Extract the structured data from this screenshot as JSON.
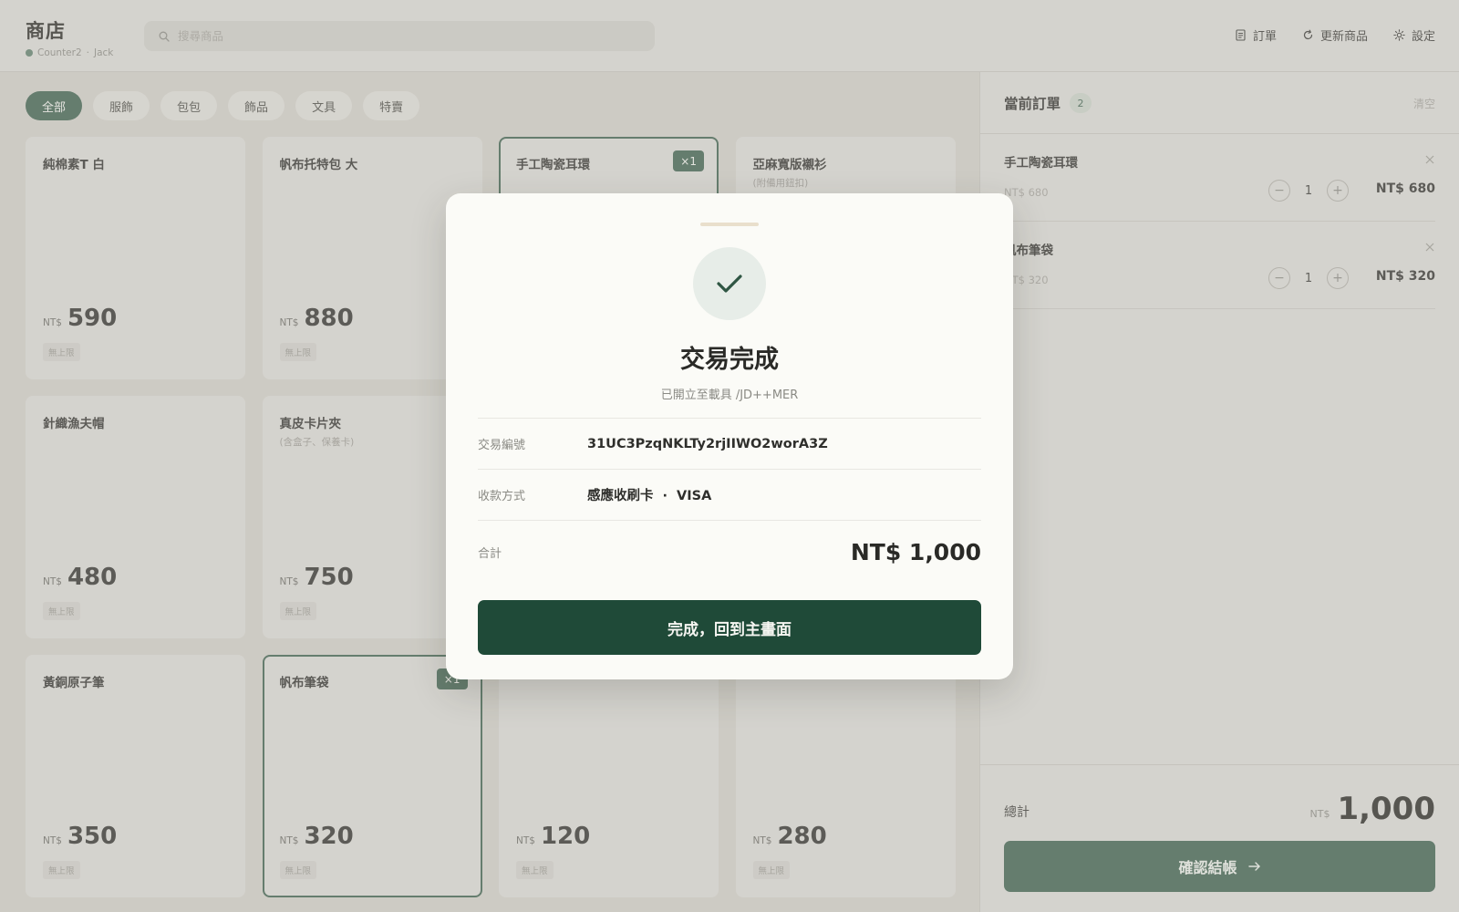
{
  "header": {
    "title": "商店",
    "device": "Counter2",
    "separator": "·",
    "user": "Jack",
    "search_placeholder": "搜尋商品",
    "actions": [
      {
        "label": "訂單",
        "icon": "receipt-icon"
      },
      {
        "label": "更新商品",
        "icon": "refresh-icon"
      },
      {
        "label": "設定",
        "icon": "gear-icon"
      }
    ]
  },
  "categories": [
    {
      "label": "全部",
      "active": true
    },
    {
      "label": "服飾",
      "active": false
    },
    {
      "label": "包包",
      "active": false
    },
    {
      "label": "飾品",
      "active": false
    },
    {
      "label": "文具",
      "active": false
    },
    {
      "label": "特賣",
      "active": false
    }
  ],
  "products": [
    {
      "name": "純棉素T 白",
      "note": "",
      "currency": "NT$",
      "price": "590",
      "badge": "無上限",
      "qty": ""
    },
    {
      "name": "帆布托特包 大",
      "note": "",
      "currency": "NT$",
      "price": "880",
      "badge": "無上限",
      "qty": ""
    },
    {
      "name": "手工陶瓷耳環",
      "note": "",
      "currency": "",
      "price": "",
      "badge": "",
      "qty": "×1"
    },
    {
      "name": "亞麻寬版襯衫",
      "note": "(附備用鈕扣)",
      "currency": "",
      "price": "",
      "badge": "",
      "qty": ""
    },
    {
      "name": "針織漁夫帽",
      "note": "",
      "currency": "NT$",
      "price": "480",
      "badge": "無上限",
      "qty": ""
    },
    {
      "name": "真皮卡片夾",
      "note": "(含盒子、保養卡)",
      "currency": "NT$",
      "price": "750",
      "badge": "無上限",
      "qty": ""
    },
    {
      "name": "",
      "note": "",
      "currency": "",
      "price": "",
      "badge": "",
      "qty": ""
    },
    {
      "name": "",
      "note": "",
      "currency": "",
      "price": "",
      "badge": "",
      "qty": ""
    },
    {
      "name": "黃銅原子筆",
      "note": "",
      "currency": "NT$",
      "price": "350",
      "badge": "無上限",
      "qty": ""
    },
    {
      "name": "帆布筆袋",
      "note": "",
      "currency": "NT$",
      "price": "320",
      "badge": "無上限",
      "qty": "×1"
    },
    {
      "name": "",
      "note": "",
      "currency": "NT$",
      "price": "120",
      "badge": "無上限",
      "qty": ""
    },
    {
      "name": "",
      "note": "",
      "currency": "NT$",
      "price": "280",
      "badge": "無上限",
      "qty": ""
    }
  ],
  "order": {
    "title": "當前訂單",
    "count": "2",
    "clear_label": "清空",
    "items": [
      {
        "name": "手工陶瓷耳環",
        "unit_price": "NT$ 680",
        "qty": "1",
        "total": "NT$ 680"
      },
      {
        "name": "帆布筆袋",
        "unit_price": "NT$ 320",
        "qty": "1",
        "total": "NT$ 320"
      }
    ],
    "stepper_minus": "−",
    "stepper_plus": "+",
    "total_label": "總計",
    "total_currency": "NT$",
    "total_value": "1,000",
    "checkout_label": "確認結帳"
  },
  "modal": {
    "title": "交易完成",
    "subtitle": "已開立至載具 /JD++MER",
    "txn_label": "交易編號",
    "txn_value": "31UC3PzqNKLTy2rjIIWO2worA3Z",
    "payment_label": "收款方式",
    "payment_method": "感應收刷卡",
    "payment_dot": "·",
    "payment_brand": "VISA",
    "total_label": "合計",
    "total_value": "NT$ 1,000",
    "done_label": "完成，回到主畫面"
  },
  "colors": {
    "accent": "#3f6150",
    "primary_button": "#1f4a38",
    "background": "#cfcdc6",
    "surface": "#d9d8d4",
    "modal_bg": "#fbfbf7"
  }
}
